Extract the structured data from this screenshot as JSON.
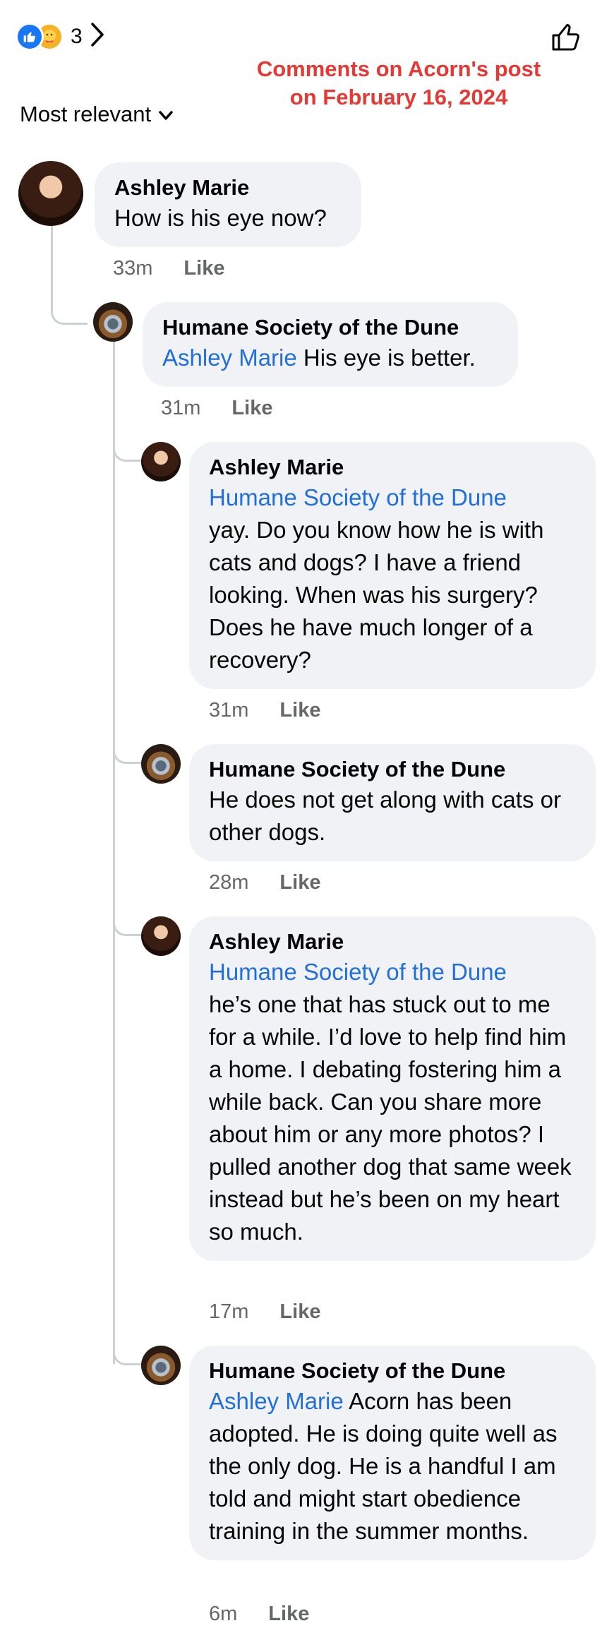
{
  "header": {
    "reaction_count": "3",
    "caption_line1": "Comments on Acorn's post",
    "caption_line2": "on February 16, 2024",
    "sort_label": "Most relevant"
  },
  "comments": [
    {
      "author": "Ashley Marie",
      "mention": "",
      "text": "How is his eye now?",
      "time": "33m",
      "like": "Like"
    },
    {
      "author": "Humane Society of the Dune",
      "mention": "Ashley Marie",
      "text": " His eye is better.",
      "time": "31m",
      "like": "Like"
    },
    {
      "author": "Ashley Marie",
      "mention": "Humane Society of the Dune",
      "text": "yay. Do you know how he is with cats and dogs? I have a friend looking. When was his surgery? Does he have much longer of a recovery?",
      "time": "31m",
      "like": "Like"
    },
    {
      "author": "Humane Society of the Dune",
      "mention": "",
      "text": "He does not get along with cats or other dogs.",
      "time": "28m",
      "like": "Like"
    },
    {
      "author": "Ashley Marie",
      "mention": "Humane Society of the Dune",
      "text": "he’s one that has stuck out to me for a while. I’d love to help find him a home. I debating fostering him a while back. Can you share more about him or any more photos? I pulled another dog that same week instead but he’s been on my heart so much.",
      "time": "17m",
      "like": "Like"
    },
    {
      "author": "Humane Society of the Dune",
      "mention": "Ashley Marie",
      "text": " Acorn has been adopted. He is doing quite well as the only dog. He is a handful I am told and might start obedience training in the summer months.",
      "time": "6m",
      "like": "Like"
    }
  ],
  "colors": {
    "mention": "#216fdb",
    "caption": "#e53935",
    "bubble": "#f0f2f5",
    "meta": "#65676b",
    "like_reaction": "#1877f2"
  },
  "icons": [
    "like-reaction-icon",
    "care-reaction-icon",
    "chevron-right-icon",
    "thumbs-up-outline-icon",
    "chevron-down-icon"
  ]
}
